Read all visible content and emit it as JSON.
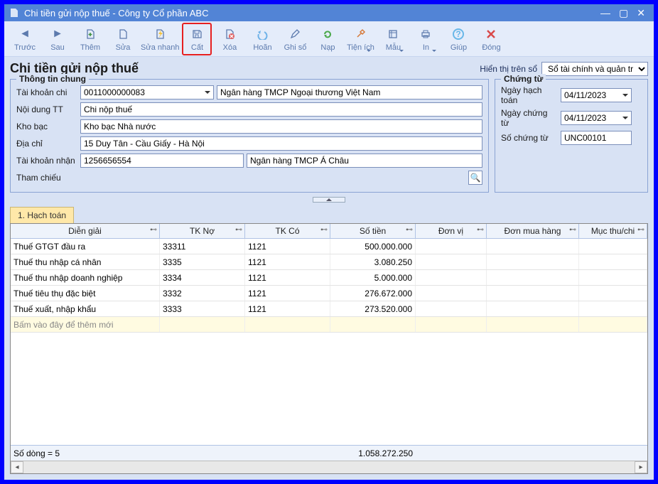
{
  "window": {
    "title": "Chi tiền gửi nộp thuế - Công ty Cổ phần ABC"
  },
  "toolbar": {
    "truoc": "Trước",
    "sau": "Sau",
    "them": "Thêm",
    "sua": "Sửa",
    "suanhanh": "Sửa nhanh",
    "cat": "Cất",
    "xoa": "Xóa",
    "hoan": "Hoãn",
    "ghiso": "Ghi sổ",
    "nap": "Nạp",
    "tienich": "Tiện ích",
    "mau": "Mẫu",
    "in": "In",
    "giup": "Giúp",
    "dong": "Đóng"
  },
  "header": {
    "title": "Chi tiền gửi nộp thuế",
    "display_label": "Hiển thị trên sổ",
    "display_value": "Sổ tài chính và quản trị"
  },
  "info": {
    "legend": "Thông tin chung",
    "tkchi_label": "Tài khoản chi",
    "tkchi_value": "0011000000083",
    "tkchi_bank": "Ngân hàng TMCP Ngoại thương Việt Nam",
    "noidung_label": "Nội dung TT",
    "noidung_value": "Chi nộp thuế",
    "khobac_label": "Kho bạc",
    "khobac_value": "Kho bạc Nhà nước",
    "diachi_label": "Địa chỉ",
    "diachi_value": "15 Duy Tân - Cầu Giấy - Hà Nội",
    "tknhan_label": "Tài khoản nhận",
    "tknhan_value": "1256656554",
    "tknhan_bank": "Ngân hàng TMCP Á Châu",
    "thamchieu_label": "Tham chiếu"
  },
  "doc": {
    "legend": "Chứng từ",
    "ngayht_label": "Ngày hạch toán",
    "ngayht_value": "04/11/2023",
    "ngayct_label": "Ngày chứng từ",
    "ngayct_value": "04/11/2023",
    "soct_label": "Số chứng từ",
    "soct_value": "UNC00101"
  },
  "tabs": {
    "hachtoan": "1. Hạch toán"
  },
  "grid": {
    "headers": {
      "dg": "Diễn giải",
      "tkno": "TK Nợ",
      "tkco": "TK Có",
      "tien": "Số tiền",
      "dv": "Đơn vị",
      "dmh": "Đơn mua hàng",
      "mtc": "Mục thu/chi"
    },
    "rows": [
      {
        "dg": "Thuế GTGT đầu ra",
        "tkno": "33311",
        "tkco": "1121",
        "tien": "500.000.000"
      },
      {
        "dg": "Thuế thu nhập cá nhân",
        "tkno": "3335",
        "tkco": "1121",
        "tien": "3.080.250"
      },
      {
        "dg": "Thuế thu nhập doanh nghiệp",
        "tkno": "3334",
        "tkco": "1121",
        "tien": "5.000.000"
      },
      {
        "dg": "Thuế tiêu thụ đặc biệt",
        "tkno": "3332",
        "tkco": "1121",
        "tien": "276.672.000"
      },
      {
        "dg": "Thuế xuất, nhập khẩu",
        "tkno": "3333",
        "tkco": "1121",
        "tien": "273.520.000"
      }
    ],
    "newrow": "Bấm vào đây để thêm mới",
    "footer": {
      "count": "Số dòng = 5",
      "total": "1.058.272.250"
    }
  }
}
